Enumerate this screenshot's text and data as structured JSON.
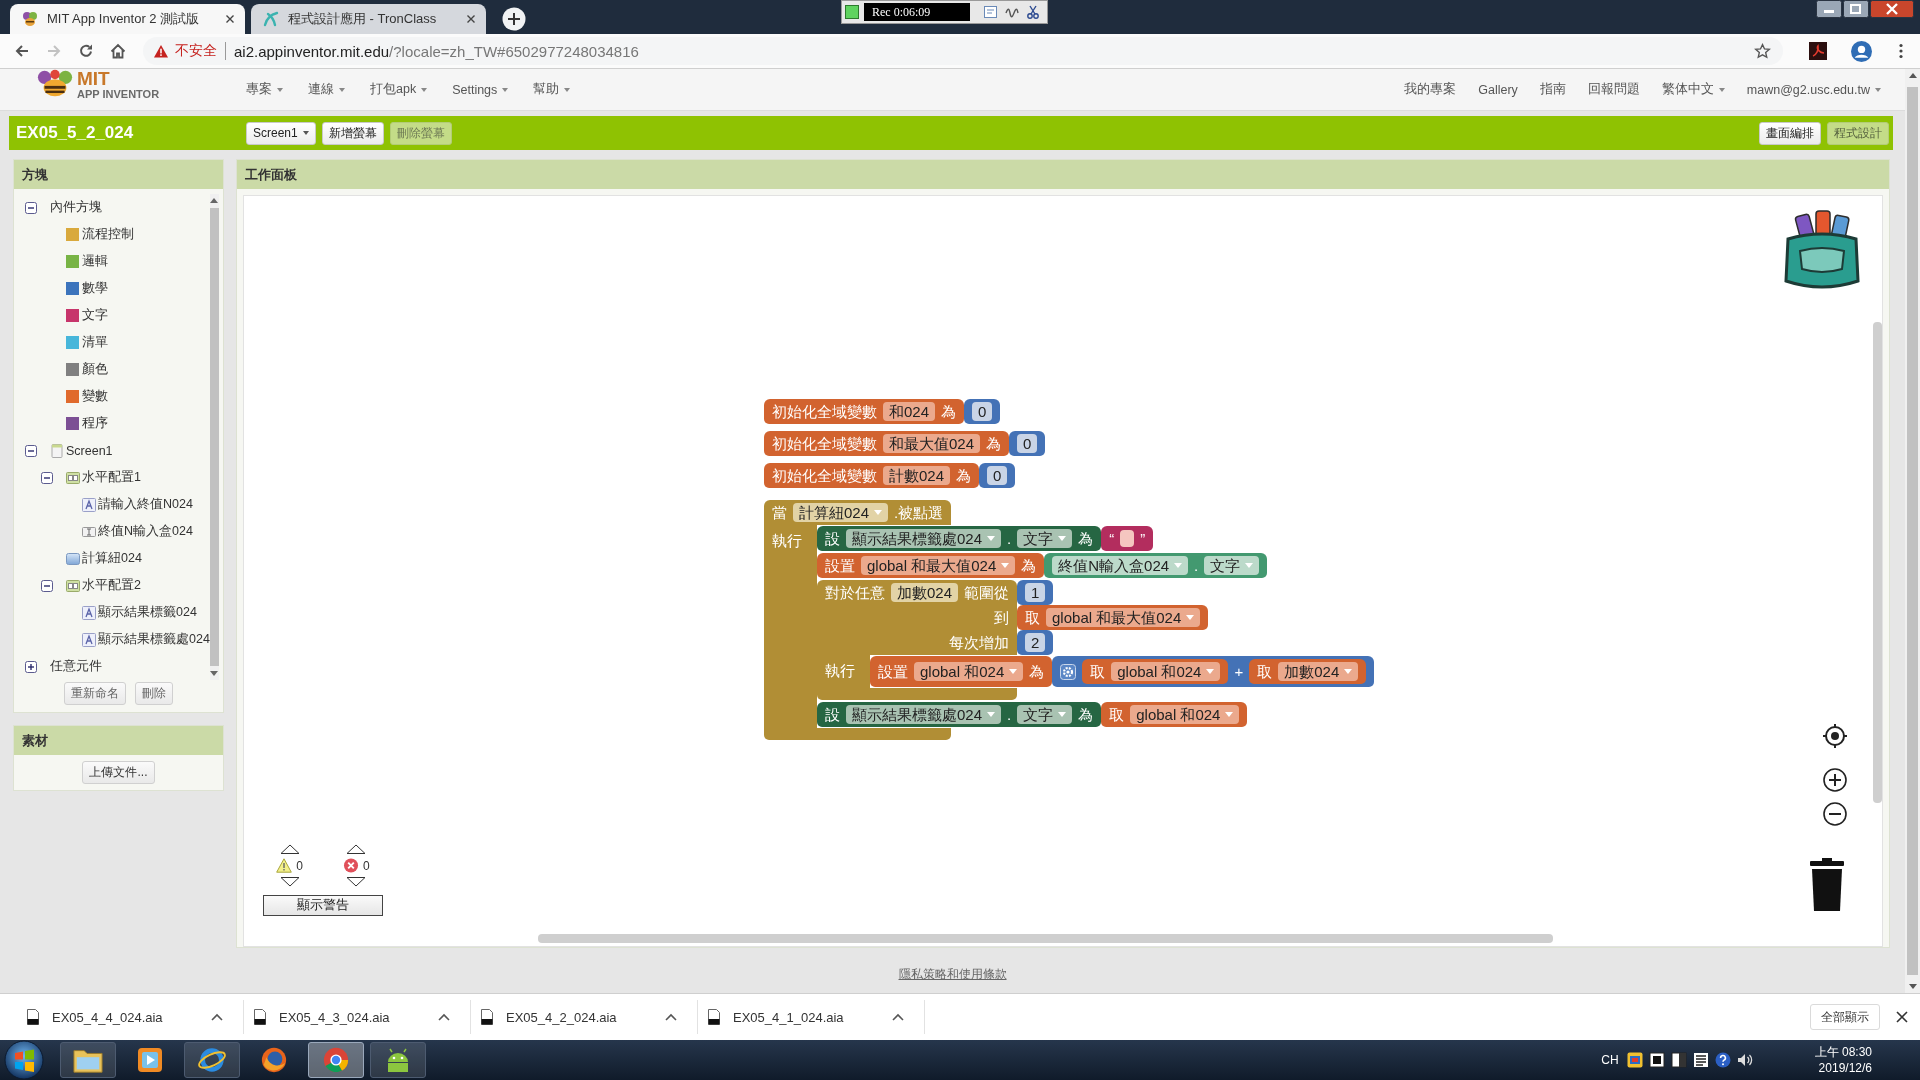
{
  "browser": {
    "tabs": [
      {
        "kind": "appinventor",
        "title": "MIT App Inventor 2 測試版",
        "selected": true
      },
      {
        "kind": "tronclass",
        "title": "程式設計應用 - TronClass",
        "selected": false
      }
    ],
    "nav_buttons": [
      {
        "kind": "back",
        "disabled": false
      },
      {
        "kind": "forward",
        "disabled": true
      },
      {
        "kind": "reload",
        "disabled": false
      },
      {
        "kind": "home",
        "disabled": false
      }
    ],
    "security": "不安全",
    "host": "ai2.appinventor.mit.edu",
    "path": "/?locale=zh_TW#6502977248034816"
  },
  "recorder": {
    "time": "Rec 0:06:09"
  },
  "app_header": {
    "logo_title": "MIT",
    "logo_subtitle": "APP INVENTOR",
    "menus": [
      "專案",
      "連線",
      "打包apk",
      "Settings",
      "幫助"
    ],
    "links": [
      {
        "label": "我的專案",
        "dropdown": false
      },
      {
        "label": "Gallery",
        "dropdown": false
      },
      {
        "label": "指南",
        "dropdown": false
      },
      {
        "label": "回報問題",
        "dropdown": false
      },
      {
        "label": "繁体中文",
        "dropdown": true
      },
      {
        "label": "mawn@g2.usc.edu.tw",
        "dropdown": true
      }
    ]
  },
  "toolbar": {
    "project": "EX05_5_2_024",
    "screen": "Screen1",
    "buttons": [
      {
        "label": "新增螢幕",
        "disabled": false
      },
      {
        "label": "刪除螢幕",
        "disabled": true
      }
    ],
    "editors": [
      {
        "label": "畫面編排",
        "selected": false
      },
      {
        "label": "程式設計",
        "selected": true
      }
    ]
  },
  "blocks_panel": {
    "title": "方塊",
    "tree": [
      {
        "label": "內件方塊",
        "kind": "group",
        "expanded": true,
        "children": [
          {
            "label": "流程控制",
            "kind": "category",
            "color": "#d9a93c"
          },
          {
            "label": "邏輯",
            "kind": "category",
            "color": "#78b445"
          },
          {
            "label": "數學",
            "kind": "category",
            "color": "#3c74bc"
          },
          {
            "label": "文字",
            "kind": "category",
            "color": "#c7356b"
          },
          {
            "label": "清單",
            "kind": "category",
            "color": "#47b6da"
          },
          {
            "label": "顏色",
            "kind": "category",
            "color": "#808080"
          },
          {
            "label": "變數",
            "kind": "category",
            "color": "#e06a2c"
          },
          {
            "label": "程序",
            "kind": "category",
            "color": "#7c4f94"
          }
        ]
      },
      {
        "label": "Screen1",
        "kind": "screen",
        "expanded": true,
        "children": [
          {
            "label": "水平配置1",
            "kind": "arrangement",
            "expanded": true,
            "children": [
              {
                "label": "請輸入終值N024",
                "kind": "label"
              },
              {
                "label": "終值N輸入盒024",
                "kind": "textbox"
              }
            ]
          },
          {
            "label": "計算紐024",
            "kind": "button"
          },
          {
            "label": "水平配置2",
            "kind": "arrangement",
            "expanded": true,
            "children": [
              {
                "label": "顯示結果標籤024",
                "kind": "label"
              },
              {
                "label": "顯示結果標籤處024",
                "kind": "label"
              }
            ]
          }
        ]
      },
      {
        "label": "任意元件",
        "kind": "group",
        "expanded": false
      }
    ],
    "actions": [
      "重新命名",
      "刪除"
    ]
  },
  "media_panel": {
    "title": "素材",
    "upload": "上傳文件..."
  },
  "workspace": {
    "title": "工作面板",
    "blocks": [
      {
        "kind": "variable",
        "rows": [
          {
            "parts": [
              {
                "kind": "label",
                "text": "初始化全域變數"
              },
              {
                "kind": "field",
                "text": "和024"
              },
              {
                "kind": "label",
                "text": "為"
              }
            ],
            "input": {
              "kind": "math",
              "rows": [
                {
                  "parts": [
                    {
                      "kind": "field",
                      "text": "0"
                    }
                  ]
                }
              ]
            }
          }
        ]
      },
      {
        "kind": "variable",
        "rows": [
          {
            "parts": [
              {
                "kind": "label",
                "text": "初始化全域變數"
              },
              {
                "kind": "field",
                "text": "和最大值024"
              },
              {
                "kind": "label",
                "text": "為"
              }
            ],
            "input": {
              "kind": "math",
              "rows": [
                {
                  "parts": [
                    {
                      "kind": "field",
                      "text": "0"
                    }
                  ]
                }
              ]
            }
          }
        ]
      },
      {
        "kind": "variable",
        "rows": [
          {
            "parts": [
              {
                "kind": "label",
                "text": "初始化全域變數"
              },
              {
                "kind": "field",
                "text": "計數024"
              },
              {
                "kind": "label",
                "text": "為"
              }
            ],
            "input": {
              "kind": "math",
              "rows": [
                {
                  "parts": [
                    {
                      "kind": "field",
                      "text": "0"
                    }
                  ]
                }
              ]
            }
          }
        ]
      },
      {
        "kind": "control",
        "rows": [
          {
            "parts": [
              {
                "kind": "label",
                "text": "當"
              },
              {
                "kind": "dropdown",
                "text": "計算紐024"
              },
              {
                "kind": "label",
                "text": ".被點選"
              }
            ]
          },
          {
            "parts": [
              {
                "kind": "label",
                "text": "執行"
              }
            ],
            "statements": [
              {
                "kind": "component_set",
                "rows": [
                  {
                    "parts": [
                      {
                        "kind": "label",
                        "text": "設"
                      },
                      {
                        "kind": "dropdown",
                        "text": "顯示結果標籤處024"
                      },
                      {
                        "kind": "label",
                        "text": "."
                      },
                      {
                        "kind": "dropdown",
                        "text": "文字"
                      },
                      {
                        "kind": "label",
                        "text": "為"
                      }
                    ],
                    "input": {
                      "kind": "text",
                      "rows": [
                        {
                          "parts": [
                            {
                              "kind": "label",
                              "text": "“"
                            },
                            {
                              "kind": "blank"
                            },
                            {
                              "kind": "label",
                              "text": "”"
                            }
                          ]
                        }
                      ]
                    }
                  }
                ]
              },
              {
                "kind": "variable",
                "rows": [
                  {
                    "parts": [
                      {
                        "kind": "label",
                        "text": "設置"
                      },
                      {
                        "kind": "dropdown",
                        "text": "global 和最大值024"
                      },
                      {
                        "kind": "label",
                        "text": "為"
                      }
                    ],
                    "input": {
                      "kind": "component_get",
                      "rows": [
                        {
                          "parts": [
                            {
                              "kind": "dropdown",
                              "text": "終值N輸入盒024"
                            },
                            {
                              "kind": "label",
                              "text": "."
                            },
                            {
                              "kind": "dropdown",
                              "text": "文字"
                            }
                          ]
                        }
                      ]
                    }
                  }
                ]
              },
              {
                "kind": "control",
                "rows": [
                  {
                    "parts": [
                      {
                        "kind": "label",
                        "text": "對於任意"
                      },
                      {
                        "kind": "field",
                        "text": "加數024"
                      },
                      {
                        "kind": "label",
                        "text": "範圍從"
                      }
                    ],
                    "input": {
                      "kind": "math",
                      "rows": [
                        {
                          "parts": [
                            {
                              "kind": "field",
                              "text": "1"
                            }
                          ]
                        }
                      ]
                    }
                  },
                  {
                    "parts": [
                      {
                        "kind": "label",
                        "text": "到"
                      }
                    ],
                    "input": {
                      "kind": "variable",
                      "rows": [
                        {
                          "parts": [
                            {
                              "kind": "label",
                              "text": "取"
                            },
                            {
                              "kind": "dropdown",
                              "text": "global 和最大值024"
                            }
                          ]
                        }
                      ]
                    }
                  },
                  {
                    "parts": [
                      {
                        "kind": "label",
                        "text": "每次增加"
                      }
                    ],
                    "input": {
                      "kind": "math",
                      "rows": [
                        {
                          "parts": [
                            {
                              "kind": "field",
                              "text": "2"
                            }
                          ]
                        }
                      ]
                    }
                  },
                  {
                    "parts": [
                      {
                        "kind": "label",
                        "text": "執行"
                      }
                    ],
                    "statements": [
                      {
                        "kind": "variable",
                        "rows": [
                          {
                            "parts": [
                              {
                                "kind": "label",
                                "text": "設置"
                              },
                              {
                                "kind": "dropdown",
                                "text": "global 和024"
                              },
                              {
                                "kind": "label",
                                "text": "為"
                              }
                            ],
                            "input": {
                              "kind": "math",
                              "rows": [
                                {
                                  "parts": [
                                    {
                                      "kind": "gear"
                                    },
                                    {
                                      "kind": "value",
                                      "block": {
                                        "kind": "variable",
                                        "rows": [
                                          {
                                            "parts": [
                                              {
                                                "kind": "label",
                                                "text": "取"
                                              },
                                              {
                                                "kind": "dropdown",
                                                "text": "global 和024"
                                              }
                                            ]
                                          }
                                        ]
                                      }
                                    },
                                    {
                                      "kind": "label",
                                      "text": "+"
                                    },
                                    {
                                      "kind": "value",
                                      "block": {
                                        "kind": "variable",
                                        "rows": [
                                          {
                                            "parts": [
                                              {
                                                "kind": "label",
                                                "text": "取"
                                              },
                                              {
                                                "kind": "dropdown",
                                                "text": "加數024"
                                              }
                                            ]
                                          }
                                        ]
                                      }
                                    }
                                  ]
                                }
                              ]
                            }
                          }
                        ]
                      }
                    ]
                  }
                ]
              },
              {
                "kind": "component_set",
                "rows": [
                  {
                    "parts": [
                      {
                        "kind": "label",
                        "text": "設"
                      },
                      {
                        "kind": "dropdown",
                        "text": "顯示結果標籤處024"
                      },
                      {
                        "kind": "label",
                        "text": "."
                      },
                      {
                        "kind": "dropdown",
                        "text": "文字"
                      },
                      {
                        "kind": "label",
                        "text": "為"
                      }
                    ],
                    "input": {
                      "kind": "variable",
                      "rows": [
                        {
                          "parts": [
                            {
                              "kind": "label",
                              "text": "取"
                            },
                            {
                              "kind": "dropdown",
                              "text": "global 和024"
                            }
                          ]
                        }
                      ]
                    }
                  }
                ]
              }
            ]
          }
        ]
      }
    ],
    "warnings": {
      "warning_count": "0",
      "error_count": "0",
      "button": "顯示警告"
    }
  },
  "footer": {
    "privacy": "隱私策略和使用條款"
  },
  "downloads": {
    "files": [
      "EX05_4_4_024.aia",
      "EX05_4_3_024.aia",
      "EX05_4_2_024.aia",
      "EX05_4_1_024.aia"
    ],
    "show_all": "全部顯示"
  },
  "taskbar": {
    "apps": [
      {
        "kind": "explorer",
        "running": true,
        "selected": false
      },
      {
        "kind": "media",
        "running": false,
        "selected": false
      },
      {
        "kind": "ie",
        "running": true,
        "selected": false
      },
      {
        "kind": "firefox",
        "running": false,
        "selected": false
      },
      {
        "kind": "chrome",
        "running": true,
        "selected": true
      },
      {
        "kind": "android",
        "running": true,
        "selected": false
      }
    ],
    "tray": {
      "language": "CH",
      "time": "上午 08:30",
      "date": "2019/12/6"
    }
  }
}
